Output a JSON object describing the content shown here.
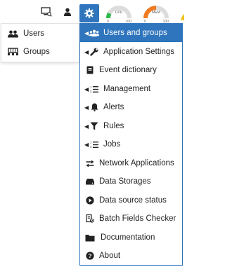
{
  "topbar": {
    "gauges": [
      {
        "label": "CPU",
        "min": "0",
        "max": "100",
        "value_fraction": 0.15,
        "color": "#2db84b"
      },
      {
        "label": "MEM",
        "min": "0",
        "max": "100",
        "value_fraction": 0.5,
        "color": "#f07b22"
      }
    ],
    "accent_color": "#2f75bd"
  },
  "left_menu": {
    "items": [
      {
        "label": "Users",
        "icon": "users-icon"
      },
      {
        "label": "Groups",
        "icon": "groups-icon"
      }
    ]
  },
  "menu": {
    "items": [
      {
        "label": "Users and groups",
        "icon": "users-icon",
        "submenu": true,
        "active": true
      },
      {
        "label": "Application Settings",
        "icon": "wrench-icon",
        "submenu": true
      },
      {
        "label": "Event dictionary",
        "icon": "book-icon",
        "submenu": false
      },
      {
        "label": "Management",
        "icon": "list-icon",
        "submenu": true
      },
      {
        "label": "Alerts",
        "icon": "bell-icon",
        "submenu": true
      },
      {
        "label": "Rules",
        "icon": "filter-icon",
        "submenu": true
      },
      {
        "label": "Jobs",
        "icon": "list-icon",
        "submenu": true
      },
      {
        "label": "Network Applications",
        "icon": "exchange-icon",
        "submenu": false
      },
      {
        "label": "Data Storages",
        "icon": "hdd-icon",
        "submenu": false
      },
      {
        "label": "Data source status",
        "icon": "play-circle-icon",
        "submenu": false
      },
      {
        "label": "Batch Fields Checker",
        "icon": "batch-icon",
        "submenu": false
      },
      {
        "label": "Documentation",
        "icon": "folder-icon",
        "submenu": false
      },
      {
        "label": "About",
        "icon": "question-circle-icon",
        "submenu": false
      }
    ]
  }
}
